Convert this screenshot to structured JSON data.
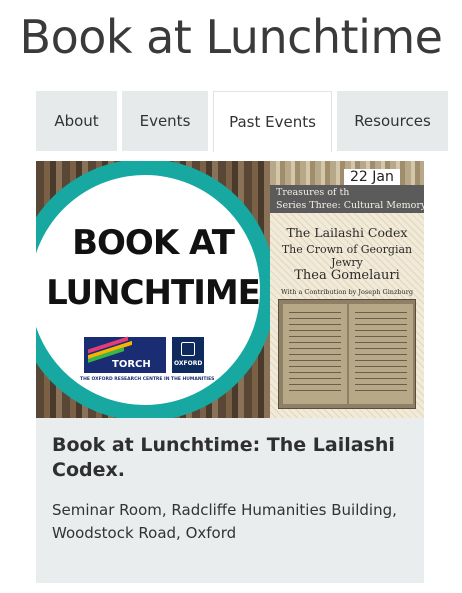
{
  "site": {
    "title": "Book at Lunchtime"
  },
  "tabs": [
    {
      "label": "About"
    },
    {
      "label": "Events"
    },
    {
      "label": "Past Events",
      "active": true
    },
    {
      "label": "Resources"
    }
  ],
  "event": {
    "date": "22 Jan",
    "title": "Book at Lunchtime: The Lailashi Codex.",
    "location": "Seminar Room, Radcliffe Humanities Building, Woodstock Road, Oxford",
    "image": {
      "logo_line1": "BOOK AT",
      "logo_line2": "LUNCHTIME",
      "torch_word": "TORCH",
      "oxford_word": "OXFORD",
      "torch_caption": "THE OXFORD RESEARCH CENTRE IN THE HUMANITIES",
      "cover_series1": "Treasures of th",
      "cover_series2": "Series Three: Cultural Memory",
      "cover_title1": "The Lailashi Codex",
      "cover_title2": "The Crown of Georgian Jewry",
      "cover_author": "Thea Gomelauri",
      "cover_contrib": "With a Contribution by Joseph Ginzburg"
    }
  },
  "colors": {
    "tab_bg": "#e6eaea",
    "card_bg": "#e9eded",
    "teal": "#16a8a1"
  }
}
